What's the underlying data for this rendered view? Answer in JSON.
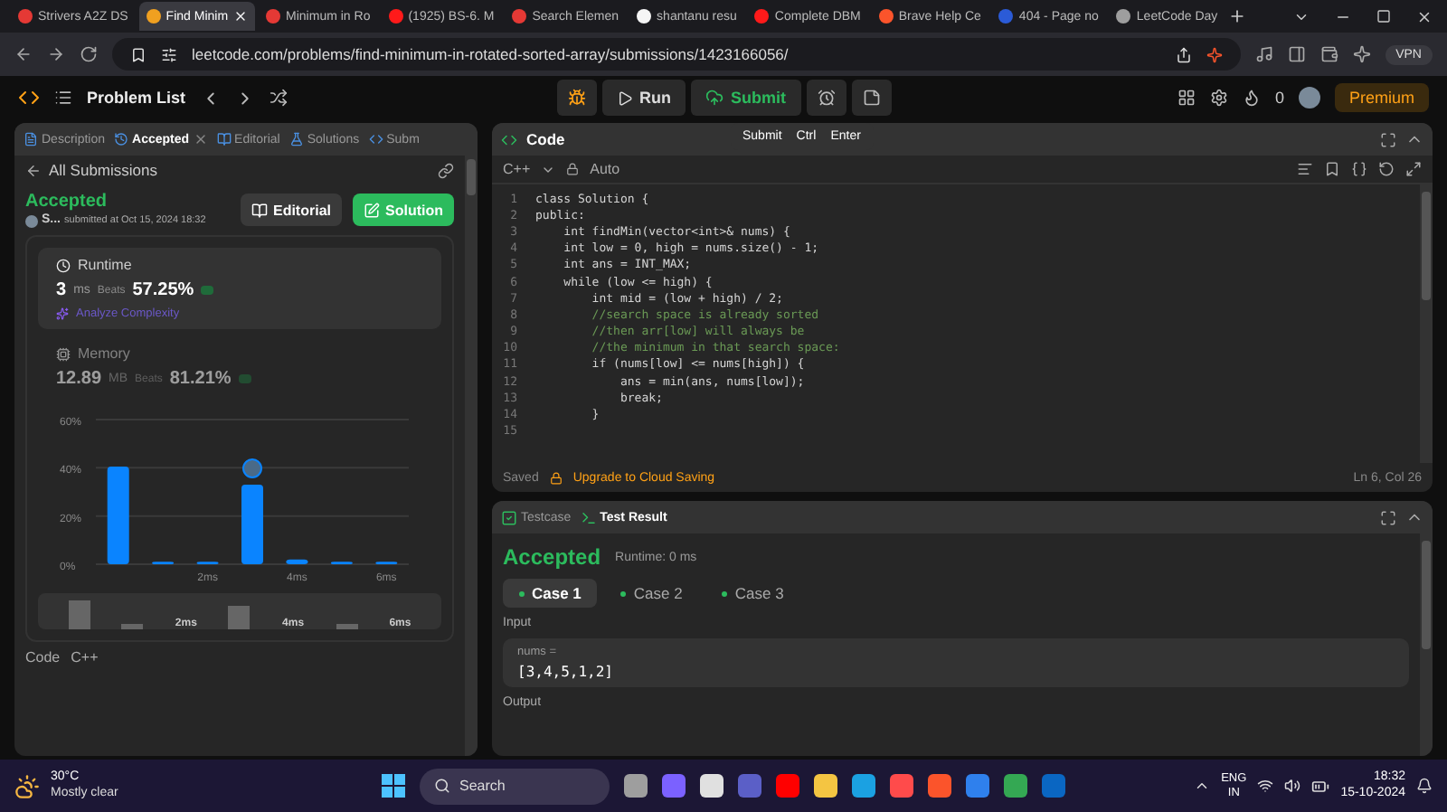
{
  "browser": {
    "tabs": [
      {
        "title": "Strivers A2Z DS",
        "selected": false,
        "color": "#e53935"
      },
      {
        "title": "Find Minim",
        "selected": true,
        "color": "#f0a020"
      },
      {
        "title": "Minimum in Ro",
        "selected": false,
        "color": "#e53935"
      },
      {
        "title": "(1925) BS-6. M",
        "selected": false,
        "color": "#ff1a1a"
      },
      {
        "title": "Search Elemen",
        "selected": false,
        "color": "#e53935"
      },
      {
        "title": "shantanu resu",
        "selected": false,
        "color": "#f5f5f5"
      },
      {
        "title": "Complete DBM",
        "selected": false,
        "color": "#ff1a1a"
      },
      {
        "title": "Brave Help Ce",
        "selected": false,
        "color": "#fb542b"
      },
      {
        "title": "404 - Page no",
        "selected": false,
        "color": "#2b5bd7"
      },
      {
        "title": "LeetCode Day",
        "selected": false,
        "color": "#9e9e9e"
      }
    ],
    "url": "leetcode.com/problems/find-minimum-in-rotated-sorted-array/submissions/1423166056/",
    "vpn": "VPN"
  },
  "nav": {
    "problem_list": "Problem List",
    "run": "Run",
    "submit": "Submit",
    "streak": "0",
    "premium": "Premium",
    "tooltip": [
      "Submit",
      "Ctrl",
      "Enter"
    ]
  },
  "left_panel": {
    "tabs": [
      {
        "label": "Description",
        "selected": false
      },
      {
        "label": "Accepted",
        "selected": true
      },
      {
        "label": "Editorial",
        "selected": false
      },
      {
        "label": "Solutions",
        "selected": false
      },
      {
        "label": "Subm",
        "selected": false
      }
    ],
    "back": "All Submissions",
    "status": "Accepted",
    "user": "S...",
    "submitted": "submitted at Oct 15, 2024 18:32",
    "editorial_button": "Editorial",
    "solution_button": "Solution",
    "runtime": {
      "title": "Runtime",
      "value": "3",
      "unit": "ms",
      "beats_label": "Beats",
      "beats": "57.25%",
      "analyze": "Analyze Complexity"
    },
    "memory": {
      "title": "Memory",
      "value": "12.89",
      "unit": "MB",
      "beats_label": "Beats",
      "beats": "81.21%"
    },
    "chart_data": {
      "type": "bar",
      "x": [
        0,
        1,
        2,
        3,
        4,
        5,
        6
      ],
      "values": [
        40.5,
        1,
        1,
        33,
        2,
        1,
        1
      ],
      "xlim": [
        -0.5,
        6.5
      ],
      "ylim": [
        0,
        60
      ],
      "yticks": [
        {
          "value": 0,
          "label": "0%"
        },
        {
          "value": 20,
          "label": "20%"
        },
        {
          "value": 40,
          "label": "40%"
        },
        {
          "value": 60,
          "label": "60%"
        }
      ],
      "xticks": [
        {
          "value": 2,
          "label": "2ms"
        },
        {
          "value": 4,
          "label": "4ms"
        },
        {
          "value": 6,
          "label": "6ms"
        }
      ]
    },
    "overview_labels": [
      "2ms",
      "4ms",
      "6ms"
    ],
    "code_label": "Code",
    "language": "C++"
  },
  "code_panel": {
    "title": "Code",
    "language": "C++",
    "mode": "Auto",
    "lines": [
      {
        "n": "1",
        "text": "class Solution {",
        "kind": "code"
      },
      {
        "n": "2",
        "text": "public:",
        "kind": "code"
      },
      {
        "n": "3",
        "text": "    int findMin(vector<int>& nums) {",
        "kind": "code"
      },
      {
        "n": "4",
        "text": "    int low = 0, high = nums.size() - 1;",
        "kind": "code"
      },
      {
        "n": "5",
        "text": "    int ans = INT_MAX;",
        "kind": "code"
      },
      {
        "n": "6",
        "text": "    while (low <= high) {",
        "kind": "code"
      },
      {
        "n": "7",
        "text": "        int mid = (low + high) / 2;",
        "kind": "code"
      },
      {
        "n": "8",
        "text": "        //search space is already sorted",
        "kind": "comment"
      },
      {
        "n": "9",
        "text": "        //then arr[low] will always be",
        "kind": "comment"
      },
      {
        "n": "10",
        "text": "        //the minimum in that search space:",
        "kind": "comment"
      },
      {
        "n": "11",
        "text": "        if (nums[low] <= nums[high]) {",
        "kind": "code"
      },
      {
        "n": "12",
        "text": "            ans = min(ans, nums[low]);",
        "kind": "code"
      },
      {
        "n": "13",
        "text": "            break;",
        "kind": "code"
      },
      {
        "n": "14",
        "text": "        }",
        "kind": "code"
      },
      {
        "n": "15",
        "kind": "blank"
      }
    ],
    "saved": "Saved",
    "upgrade": "Upgrade to Cloud Saving",
    "cursor": "Ln 6, Col 26"
  },
  "test_panel": {
    "tabs": [
      {
        "label": "Testcase",
        "selected": false
      },
      {
        "label": "Test Result",
        "selected": true
      }
    ],
    "status": "Accepted",
    "runtime": "Runtime: 0 ms",
    "cases": [
      {
        "label": "Case 1",
        "selected": true
      },
      {
        "label": "Case 2",
        "selected": false
      },
      {
        "label": "Case 3",
        "selected": false
      }
    ],
    "input_label": "Input",
    "param": "nums =",
    "value": "[3,4,5,1,2]",
    "output_label": "Output"
  },
  "taskbar": {
    "temp": "30°C",
    "weather": "Mostly clear",
    "search": "Search",
    "apps": [
      {
        "color": "#9e9e9e"
      },
      {
        "color": "#7b61ff"
      },
      {
        "color": "#e0e0e0"
      },
      {
        "color": "#5b5fc7"
      },
      {
        "color": "#ff0000"
      },
      {
        "color": "#f4c542"
      },
      {
        "color": "#1ba1e2"
      },
      {
        "color": "#ff4b4b"
      },
      {
        "color": "#fb542b"
      },
      {
        "color": "#2f80ed"
      },
      {
        "color": "#34a853"
      },
      {
        "color": "#0a66c2"
      }
    ],
    "lang": "ENG",
    "region": "IN",
    "time": "18:32",
    "date": "15-10-2024"
  }
}
